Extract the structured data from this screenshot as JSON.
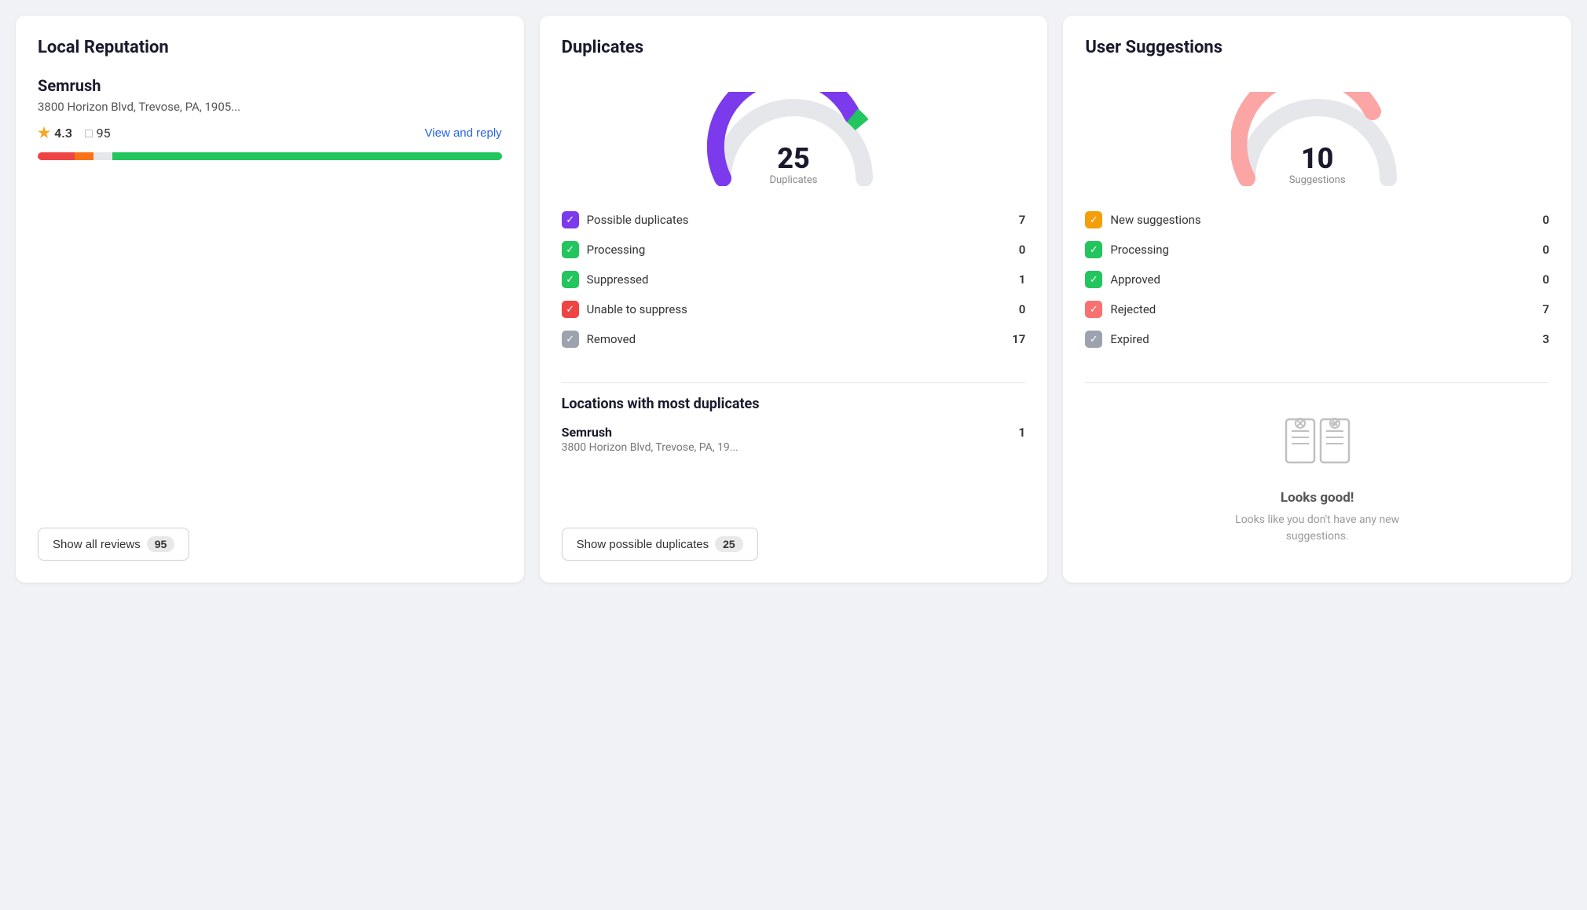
{
  "localReputation": {
    "title": "Local Reputation",
    "business": {
      "name": "Semrush",
      "address": "3800 Horizon Blvd, Trevose, PA, 1905...",
      "rating": "4.3",
      "reviewCount": "95",
      "viewReplyLabel": "View and reply"
    },
    "ratingBar": [
      {
        "color": "#ef4444",
        "width": 8
      },
      {
        "color": "#f97316",
        "width": 4
      },
      {
        "color": "#e5e7eb",
        "width": 4
      },
      {
        "color": "#22c55e",
        "width": 84
      }
    ],
    "showAllReviews": {
      "label": "Show all reviews",
      "count": "95"
    }
  },
  "duplicates": {
    "title": "Duplicates",
    "gauge": {
      "number": "25",
      "label": "Duplicates"
    },
    "stats": [
      {
        "label": "Possible duplicates",
        "count": "7",
        "iconType": "purple"
      },
      {
        "label": "Processing",
        "count": "0",
        "iconType": "green"
      },
      {
        "label": "Suppressed",
        "count": "1",
        "iconType": "green"
      },
      {
        "label": "Unable to suppress",
        "count": "0",
        "iconType": "red"
      },
      {
        "label": "Removed",
        "count": "17",
        "iconType": "gray"
      }
    ],
    "locationsTitle": "Locations with most duplicates",
    "locations": [
      {
        "name": "Semrush",
        "address": "3800 Horizon Blvd, Trevose, PA, 19...",
        "count": "1"
      }
    ],
    "showButton": {
      "label": "Show possible duplicates",
      "count": "25"
    }
  },
  "userSuggestions": {
    "title": "User Suggestions",
    "gauge": {
      "number": "10",
      "label": "Suggestions"
    },
    "stats": [
      {
        "label": "New suggestions",
        "count": "0",
        "iconType": "yellow"
      },
      {
        "label": "Processing",
        "count": "0",
        "iconType": "green"
      },
      {
        "label": "Approved",
        "count": "0",
        "iconType": "green"
      },
      {
        "label": "Rejected",
        "count": "7",
        "iconType": "pink"
      },
      {
        "label": "Expired",
        "count": "3",
        "iconType": "gray"
      }
    ],
    "emptyState": {
      "title": "Looks good!",
      "description": "Looks like you don't have any new suggestions."
    }
  },
  "icons": {
    "star": "★",
    "comment": "💬",
    "checkmark": "✓",
    "crossmark": "✕"
  }
}
